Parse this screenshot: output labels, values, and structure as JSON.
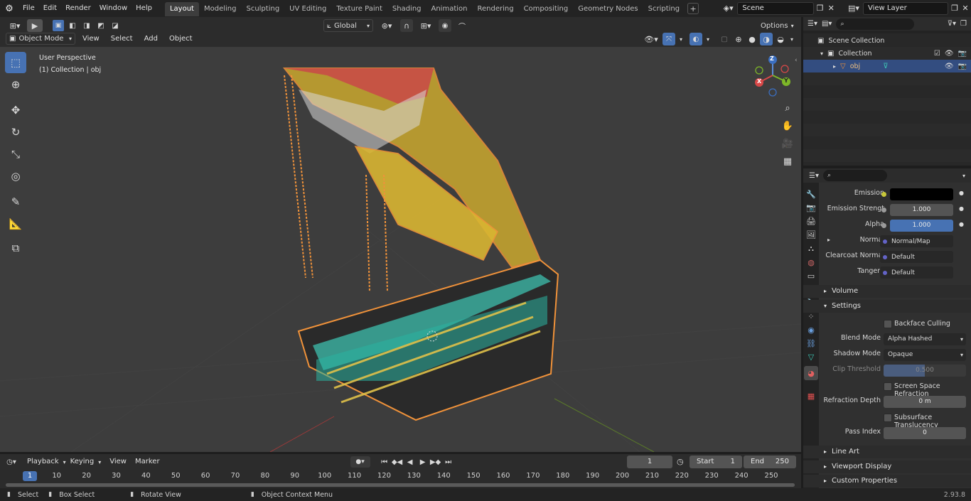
{
  "app": {
    "version": "2.93.8"
  },
  "top_menu": [
    "File",
    "Edit",
    "Render",
    "Window",
    "Help"
  ],
  "workspaces": [
    "Layout",
    "Modeling",
    "Sculpting",
    "UV Editing",
    "Texture Paint",
    "Shading",
    "Animation",
    "Rendering",
    "Compositing",
    "Geometry Nodes",
    "Scripting"
  ],
  "active_workspace": "Layout",
  "scene": {
    "name": "Scene",
    "view_layer": "View Layer"
  },
  "viewport_header": {
    "transform_orientation": "Global",
    "options_label": "Options",
    "mode": "Object Mode",
    "menus": [
      "View",
      "Select",
      "Add",
      "Object"
    ]
  },
  "viewport": {
    "perspective": "User Perspective",
    "collection_info": "(1) Collection | obj"
  },
  "gizmo": {
    "x": "X",
    "y": "Y",
    "z": "Z"
  },
  "outliner": {
    "root": "Scene Collection",
    "collection": "Collection",
    "object": "obj"
  },
  "material_props": {
    "emission_label": "Emission",
    "emission_strength_label": "Emission Strengt",
    "emission_strength": "1.000",
    "alpha_label": "Alpha",
    "alpha": "1.000",
    "normal_label": "Normal",
    "normal_value": "Normal/Map",
    "clearcoat_label": "Clearcoat Normal",
    "clearcoat_value": "Default",
    "tangent_label": "Tangent",
    "tangent_value": "Default",
    "volume": "Volume",
    "settings": "Settings",
    "backface_culling": "Backface Culling",
    "blend_mode_label": "Blend Mode",
    "blend_mode": "Alpha Hashed",
    "shadow_mode_label": "Shadow Mode",
    "shadow_mode": "Opaque",
    "clip_threshold_label": "Clip Threshold",
    "clip_threshold": "0.500",
    "ssr": "Screen Space Refraction",
    "refraction_depth_label": "Refraction Depth",
    "refraction_depth": "0 m",
    "subsurface": "Subsurface Translucency",
    "pass_index_label": "Pass Index",
    "pass_index": "0",
    "line_art": "Line Art",
    "viewport_display": "Viewport Display",
    "custom_properties": "Custom Properties"
  },
  "timeline": {
    "menus": [
      "Playback",
      "Keying",
      "View",
      "Marker"
    ],
    "current_frame": "1",
    "start_label": "Start",
    "start": "1",
    "end_label": "End",
    "end": "250",
    "ticks": [
      "1",
      "10",
      "20",
      "30",
      "40",
      "50",
      "60",
      "70",
      "80",
      "90",
      "100",
      "110",
      "120",
      "130",
      "140",
      "150",
      "160",
      "170",
      "180",
      "190",
      "200",
      "210",
      "220",
      "230",
      "240",
      "250"
    ]
  },
  "statusbar": {
    "select": "Select",
    "box_select": "Box Select",
    "rotate_view": "Rotate View",
    "context_menu": "Object Context Menu"
  },
  "colors": {
    "accent": "#4772b3",
    "selection_outline": "#f0923a",
    "active_row": "#334d80"
  }
}
